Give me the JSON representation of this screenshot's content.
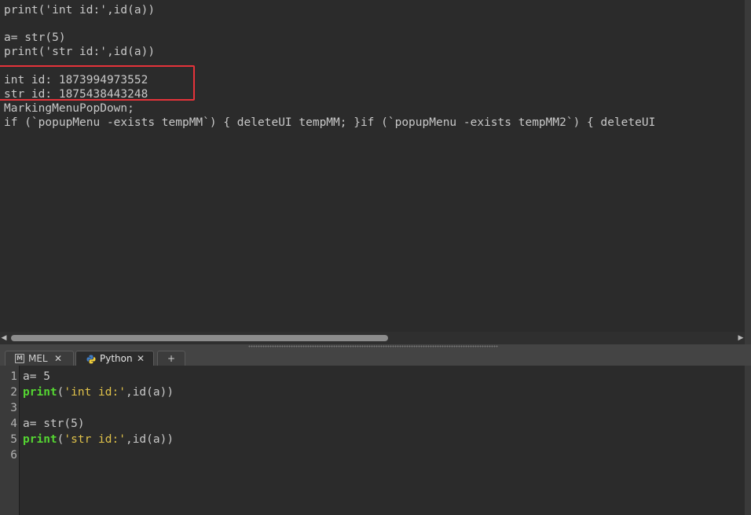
{
  "output": {
    "lines": [
      "print('int id:',id(a))",
      "",
      "a= str(5)",
      "print('str id:',id(a))",
      "",
      "int id: 1873994973552",
      "str id: 1875438443248",
      "MarkingMenuPopDown;",
      "if (`popupMenu -exists tempMM`) { deleteUI tempMM; }if (`popupMenu -exists tempMM2`) { deleteUI"
    ]
  },
  "highlight_color": "#e5333a",
  "tabs": [
    {
      "label": "MEL",
      "icon": "mel-script-icon",
      "close": "✕"
    },
    {
      "label": "Python",
      "icon": "python-icon",
      "close": "✕"
    },
    {
      "label": "+"
    }
  ],
  "editor": {
    "line_numbers": [
      "1",
      "2",
      "3",
      "4",
      "5",
      "6"
    ],
    "code": [
      {
        "plain": "a= 5"
      },
      {
        "kw": "print",
        "open": "(",
        "str": "'int id:'",
        "rest": ",id(a))"
      },
      {
        "plain": ""
      },
      {
        "plain": "a= str(5)"
      },
      {
        "kw": "print",
        "open": "(",
        "str": "'str id:'",
        "rest": ",id(a))"
      },
      {
        "plain": ""
      }
    ]
  },
  "scroll": {
    "left_arrow": "◀",
    "right_arrow": "▶"
  },
  "colors": {
    "keyword": "#55d632",
    "string": "#e0c24a",
    "background": "#2b2b2b"
  }
}
